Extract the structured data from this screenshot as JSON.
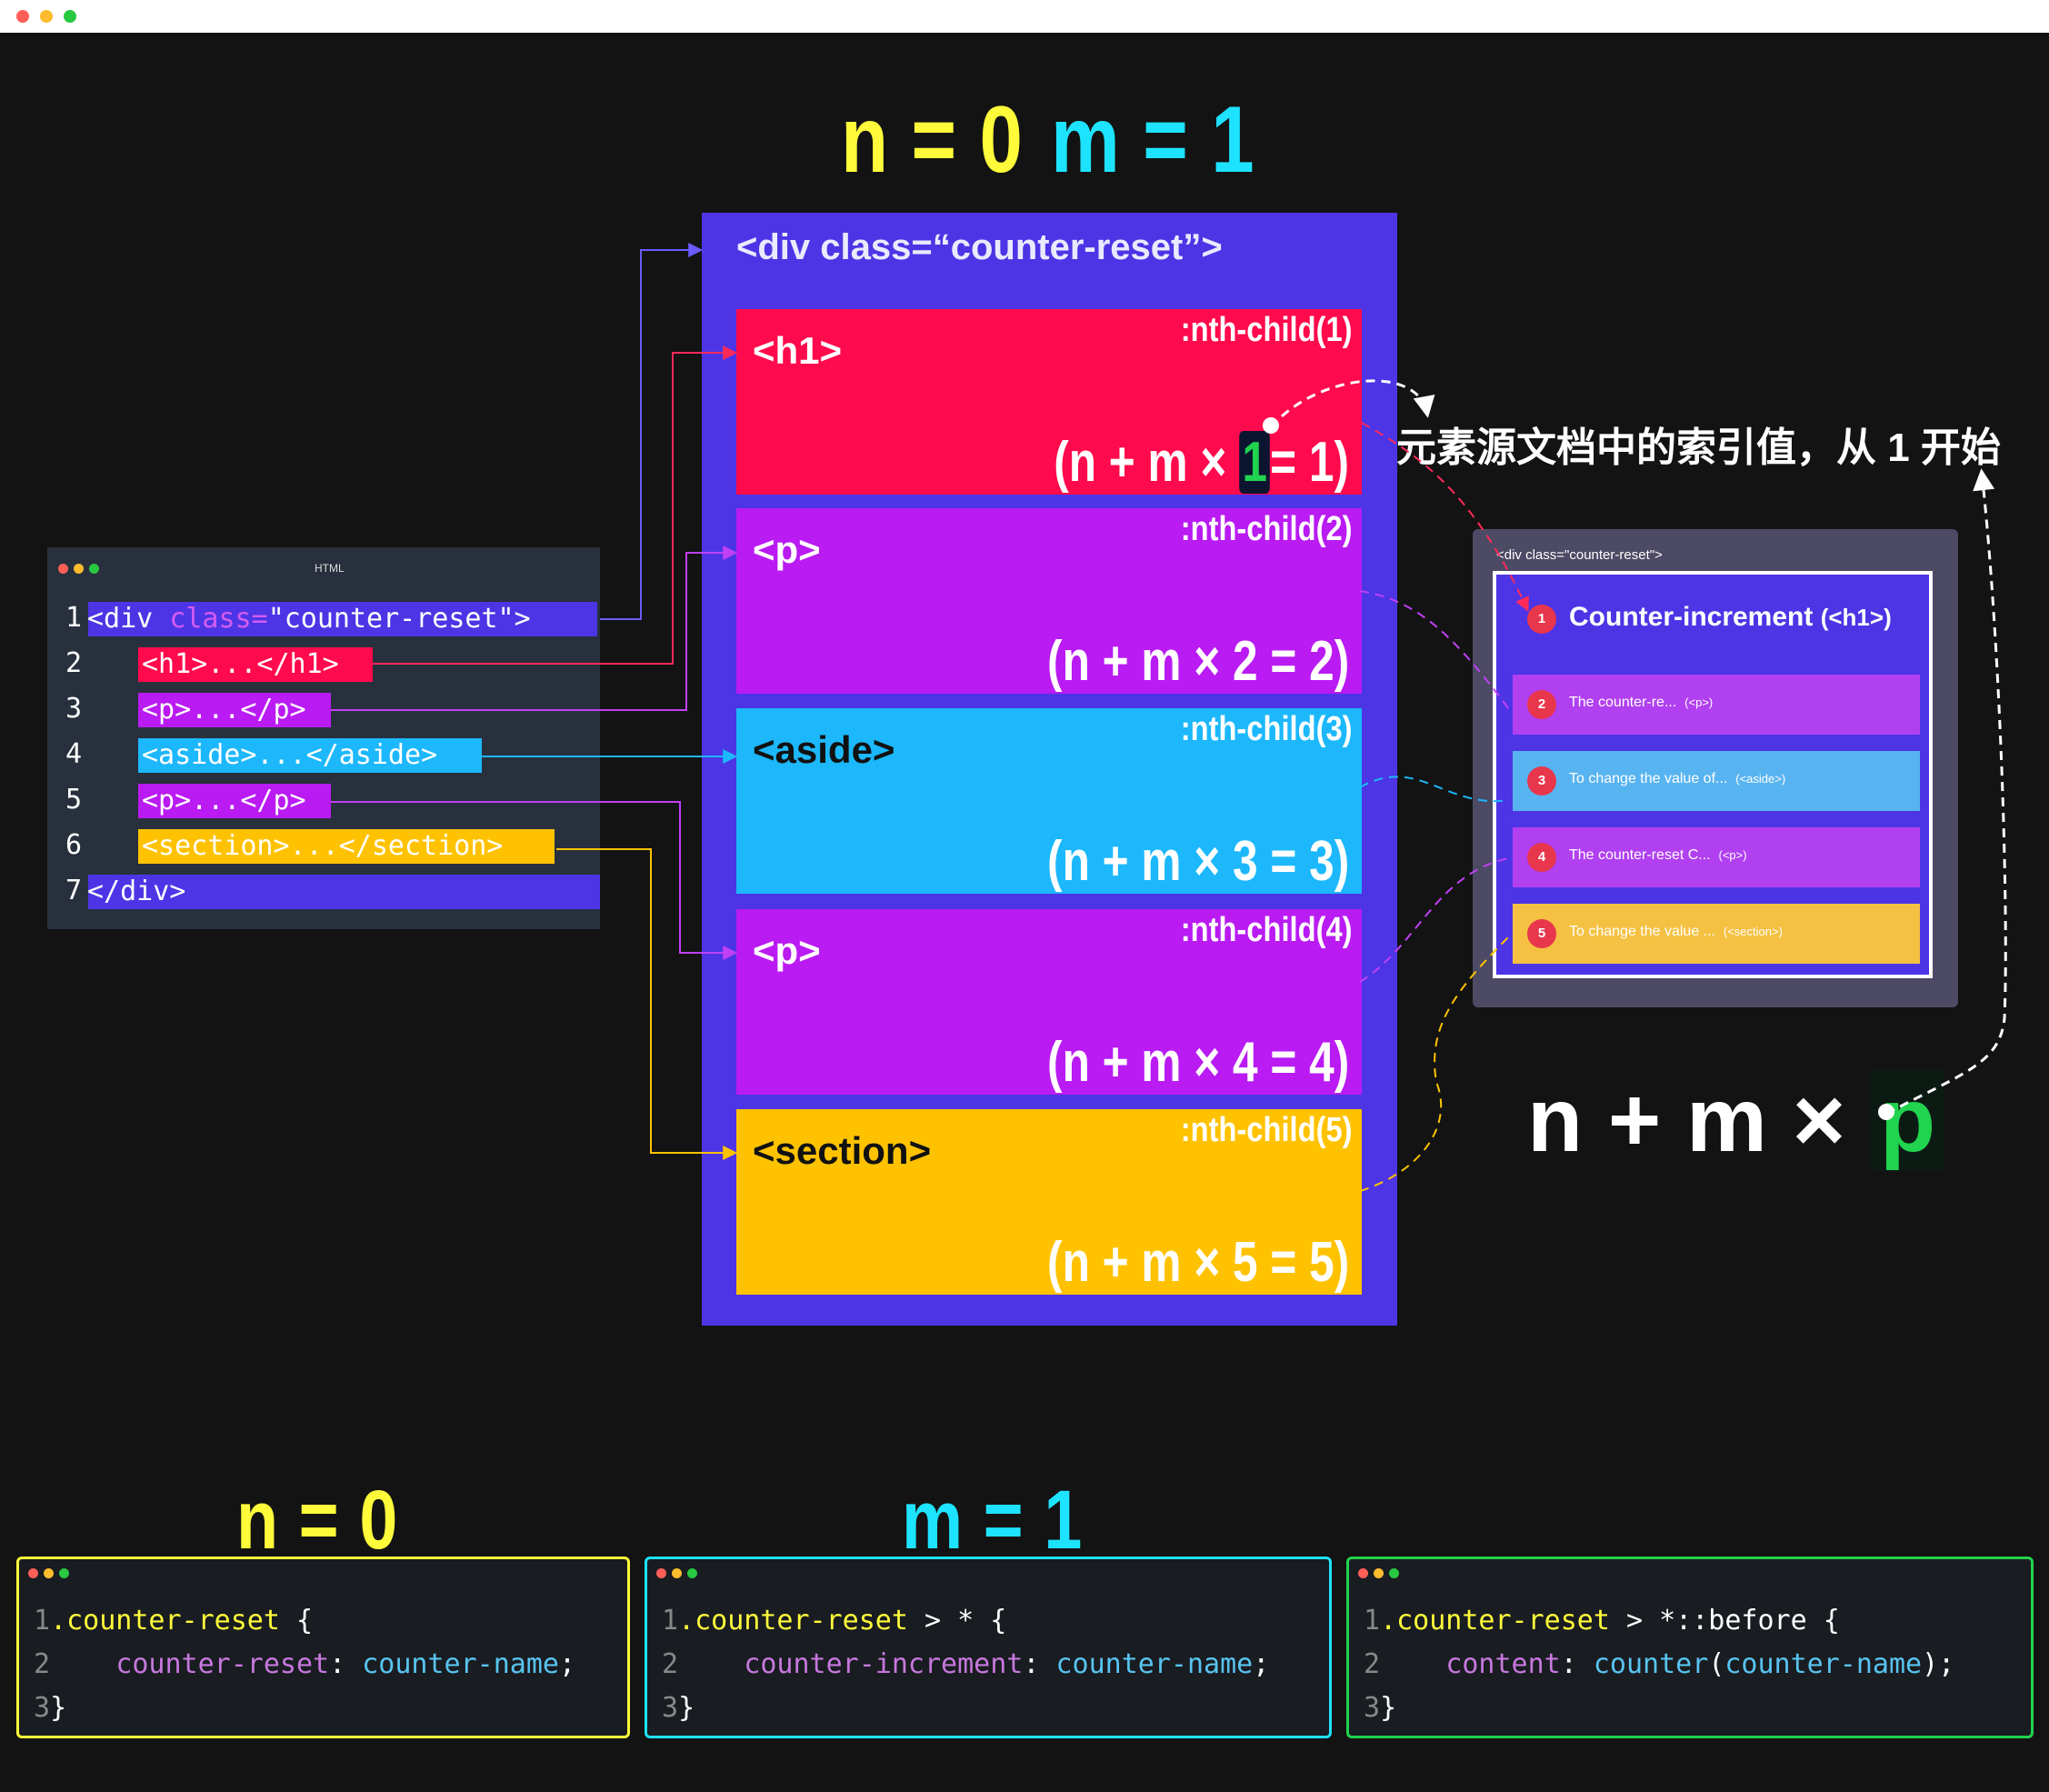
{
  "top_heading": {
    "n_text": "n = 0",
    "m_text": "m = 1"
  },
  "container": {
    "label": "<div class=“counter-reset”>",
    "children": [
      {
        "tag": "<h1>",
        "nth": ":nth-child(1)",
        "formula_pre": "(n + m × ",
        "formula_p": "1",
        "formula_post": "= 1)",
        "color": "#ff0a4c"
      },
      {
        "tag": "<p>",
        "nth": ":nth-child(2)",
        "formula": "(n + m × 2 = 2)",
        "color": "#b91bf2"
      },
      {
        "tag": "<aside>",
        "nth": ":nth-child(3)",
        "formula": "(n + m × 3 = 3)",
        "color": "#1cb8fb"
      },
      {
        "tag": "<p>",
        "nth": ":nth-child(4)",
        "formula": "(n + m × 4 = 4)",
        "color": "#b91bf2"
      },
      {
        "tag": "<section>",
        "nth": ":nth-child(5)",
        "formula": "(n + m × 5 = 5)",
        "color": "#ffc200"
      }
    ]
  },
  "annotation": "元素源文档中的索引值，从 1 开始",
  "formula_main": {
    "text": "n + m ×",
    "p": "p"
  },
  "html_panel": {
    "title": "HTML",
    "lines": [
      {
        "num": "1",
        "open": "<div ",
        "attr": "class=",
        "val": "\"counter-reset\"",
        "close": ">"
      },
      {
        "num": "2",
        "text": "<h1>...</h1>"
      },
      {
        "num": "3",
        "text": "<p>...</p>"
      },
      {
        "num": "4",
        "text": "<aside>...</aside>"
      },
      {
        "num": "5",
        "text": "<p>...</p>"
      },
      {
        "num": "6",
        "text": "<section>...</section>"
      },
      {
        "num": "7",
        "text": "</div>"
      }
    ]
  },
  "result_panel": {
    "label": "<div class=\"counter-reset\">",
    "items": [
      {
        "num": "1",
        "text": "Counter-increment",
        "tag": "(<h1>)"
      },
      {
        "num": "2",
        "text": "The counter-re...",
        "tag": "(<p>)"
      },
      {
        "num": "3",
        "text": "To change the value of...",
        "tag": "(<aside>)"
      },
      {
        "num": "4",
        "text": "The counter-reset C...",
        "tag": "(<p>)"
      },
      {
        "num": "5",
        "text": "To change the value ...",
        "tag": "(<section>)"
      }
    ]
  },
  "bottom": {
    "n_label": "n = 0",
    "m_label": "m = 1",
    "panels": [
      {
        "l1_sel": ".counter-reset",
        "l1_rest": " {",
        "l2_prop": "counter-reset",
        "l2_val": "counter-name",
        "l2_end": ";"
      },
      {
        "l1_sel": ".counter-reset",
        "l1_rest": " > * {",
        "l2_prop": "counter-increment",
        "l2_val": "counter-name",
        "l2_end": ";"
      },
      {
        "l1_sel": ".counter-reset",
        "l1_rest": " > *::before {",
        "l2_prop": "content",
        "l2_func": "counter",
        "l2_val": "counter-name",
        "l2_end": ");"
      }
    ],
    "line_numbers": [
      "1",
      "2",
      "3"
    ],
    "close_brace": "}"
  },
  "colors": {
    "yellow": "#fffb3a",
    "cyan": "#1ee3ff",
    "green": "#21d34e",
    "container": "#4d35e6"
  }
}
